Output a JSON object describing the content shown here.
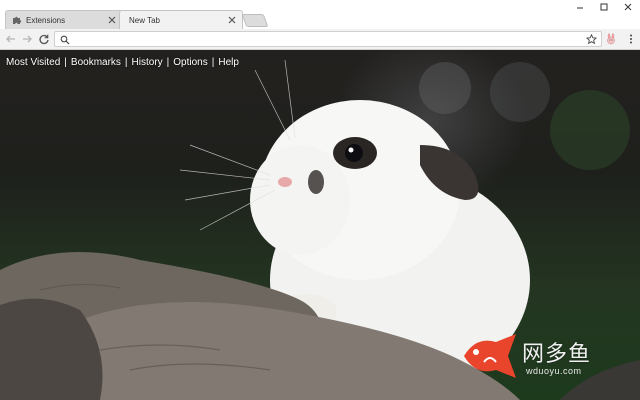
{
  "tabs": [
    {
      "title": "Extensions",
      "icon": "puzzle-icon",
      "state": "inactive"
    },
    {
      "title": "New Tab",
      "icon": "none",
      "state": "active"
    }
  ],
  "window_controls": [
    "minimize-icon",
    "maximize-icon",
    "close-icon"
  ],
  "toolbar": {
    "omnibox": {
      "value": "",
      "placeholder": ""
    },
    "extension_icon": "rabbit-extension-icon"
  },
  "nav": {
    "links": [
      "Most Visited",
      "Bookmarks",
      "History",
      "Options",
      "Help"
    ],
    "separator": "|"
  },
  "watermark": {
    "chinese": "网多鱼",
    "url": "wduoyu.com",
    "logo_color": "#e8452c"
  },
  "colors": {
    "tab_active_bg": "#f2f2f2",
    "tab_inactive_bg": "#dcdcdc",
    "nav_text": "#ffffff"
  }
}
